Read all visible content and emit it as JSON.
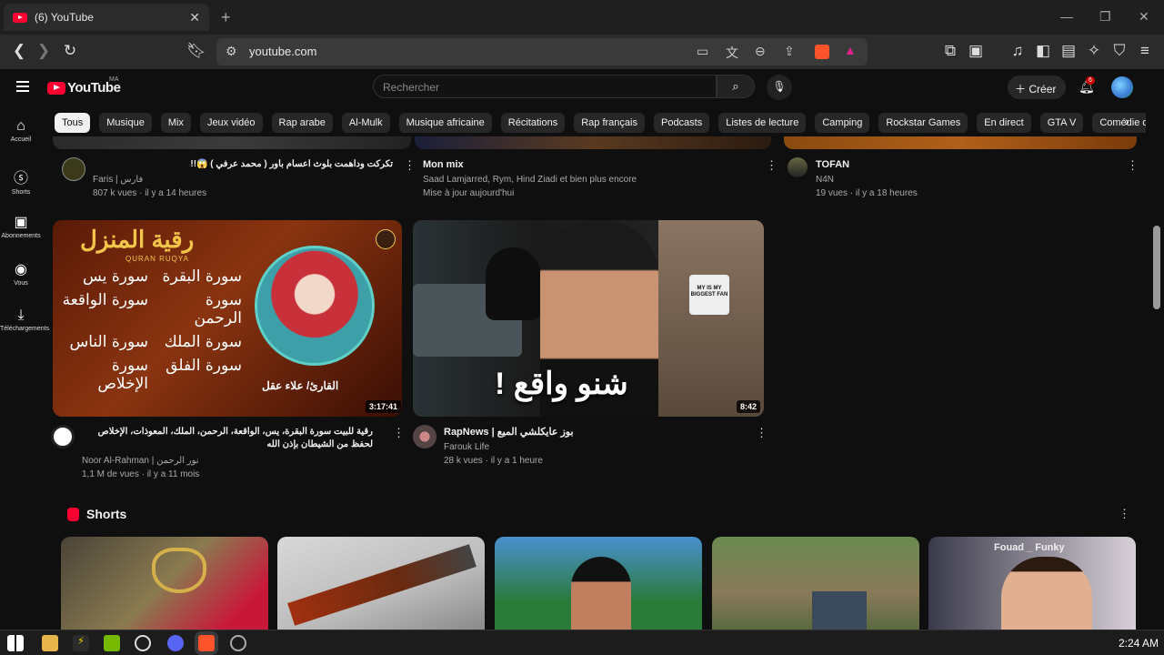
{
  "browser": {
    "tab_title": "(6) YouTube",
    "url": "youtube.com"
  },
  "youtube": {
    "logo_text": "YouTube",
    "country": "MA",
    "search_placeholder": "Rechercher",
    "create_label": "Créer",
    "notification_count": "6"
  },
  "sidebar": [
    {
      "label": "Accueil",
      "icon": "home-icon"
    },
    {
      "label": "Shorts",
      "icon": "shorts-icon"
    },
    {
      "label": "Abonnements",
      "icon": "subscriptions-icon"
    },
    {
      "label": "Vous",
      "icon": "you-icon"
    },
    {
      "label": "Téléchargements",
      "icon": "download-icon"
    }
  ],
  "chips": [
    "Tous",
    "Musique",
    "Mix",
    "Jeux vidéo",
    "Rap arabe",
    "Al-Mulk",
    "Musique africaine",
    "Récitations",
    "Rap français",
    "Podcasts",
    "Listes de lecture",
    "Camping",
    "Rockstar Games",
    "En direct",
    "GTA V",
    "Comédie d"
  ],
  "row1": [
    {
      "title": "تكركت وداهمت بلوث اعسام باور ( محمد عرفي ) 😱!!",
      "channel": "Faris | فارس",
      "meta": "807 k vues · il y a 14 heures"
    },
    {
      "title": "Mon mix",
      "channel": "Saad Lamjarred, Rym, Hind Ziadi et bien plus encore",
      "meta": "Mise à jour aujourd'hui"
    },
    {
      "title": "TOFAN",
      "channel": "N4N",
      "meta": "19 vues · il y a 18 heures"
    }
  ],
  "row2": [
    {
      "title": "رقية للبيت سورة البقرة، يس، الواقعة، الرحمن، الملك، المعوذات، الإخلاص لحفظ من الشيطان بإذن الله",
      "channel": "Noor Al-Rahman | نور الرحمن",
      "meta": "1,1 M de vues · il y a 11 mois",
      "duration": "3:17:41",
      "thumb_heading": "رقية المنزل",
      "thumb_sub": "QURAN RUQYA",
      "thumb_reader": "القارئ/ علاء عقل",
      "thumb_surahs": [
        "سورة البقرة",
        "سورة يس",
        "سورة الرحمن",
        "سورة الواقعة",
        "سورة الملك",
        "سورة الناس",
        "سورة الفلق",
        "سورة الإخلاص"
      ]
    },
    {
      "title": "RapNews | بوز عايكلشي الميع",
      "channel": "Farouk Life",
      "meta": "28 k vues · il y a 1 heure",
      "duration": "8:42",
      "thumb_text": "شنو واقع !",
      "shirt_text": "MY IS MY BIGGEST FAN"
    }
  ],
  "shorts": {
    "heading": "Shorts",
    "overlay_text": "Fouad _ Funky"
  },
  "taskbar": {
    "time": "2:24 AM"
  }
}
